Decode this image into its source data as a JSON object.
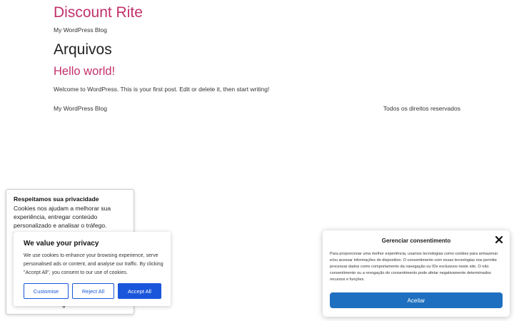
{
  "site": {
    "title": "Discount Rite",
    "tagline": "My WordPress Blog"
  },
  "archive": {
    "heading": "Arquivos"
  },
  "post": {
    "title": "Hello world!",
    "excerpt": "Welcome to WordPress. This is your first post. Edit or delete it, then start writing!"
  },
  "footer": {
    "left": "My WordPress Blog",
    "right": "Todos os direitos reservados"
  },
  "privacy_panel": {
    "title": "Respeitamos sua privacidade",
    "text": "Cookies nos ajudam a melhorar sua experiência, entregar conteúdo personalizado e analisar o tráfego. Você",
    "peek_text": "g"
  },
  "value_banner": {
    "title": "We value your privacy",
    "text": "We use cookies to enhance your browsing experience, serve personalised ads or content, and analyse our traffic. By clicking \"Accept All\", you consent to our use of cookies.",
    "customise_label": "Customise",
    "reject_label": "Reject All",
    "accept_label": "Accept All"
  },
  "consent_dialog": {
    "title": "Gerenciar consentimento",
    "close_icon": "close-icon",
    "text": "Para proporcionar uma melhor experiência, usamos tecnologias como cookies para armazenar e/ou acessar informações do dispositivo. O consentimento com essas tecnologias nos permite processar dados como comportamento da navegação ou IDs exclusivos neste site. O não consentimento ou a revogação do consentimento pode afetar negativamente determinados recursos e funções.",
    "accept_label": "Aceitar"
  },
  "colors": {
    "brand": "#c2306a",
    "primary_blue": "#1a56db",
    "consent_blue": "#1e6fbf"
  }
}
